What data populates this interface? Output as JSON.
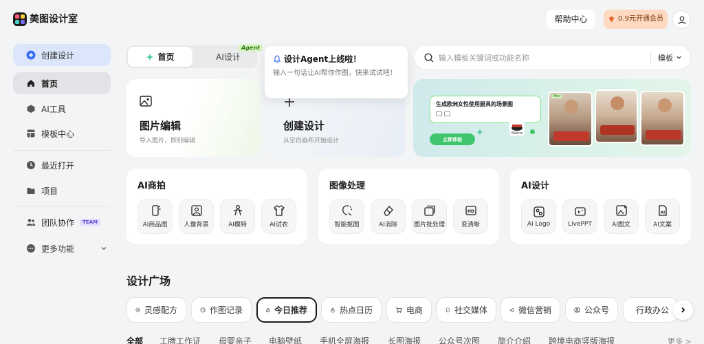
{
  "header": {
    "app_name": "美图设计室",
    "help_label": "帮助中心",
    "vip_label": "0.9元开通会员"
  },
  "sidebar": {
    "create_label": "创建设计",
    "items": [
      {
        "label": "首页"
      },
      {
        "label": "AI工具"
      },
      {
        "label": "模板中心"
      },
      {
        "label": "最近打开"
      },
      {
        "label": "项目"
      },
      {
        "label": "团队协作",
        "badge": "TEAM"
      },
      {
        "label": "更多功能"
      }
    ]
  },
  "top_tabs": {
    "home": "首页",
    "ai_design": "AI设计",
    "agent_tag": "Agent"
  },
  "popover": {
    "title": "设计Agent上线啦！",
    "body": "输入一句话让AI帮你作图，快来试试吧！"
  },
  "search": {
    "placeholder": "输入模板关键词或功能名称",
    "type_label": "模板"
  },
  "cards": {
    "edit": {
      "title": "图片编辑",
      "sub": "导入图片，即刻编辑"
    },
    "create": {
      "title": "创建设计",
      "sub": "从空白画布开始设计"
    }
  },
  "banner": {
    "prompt": "生成欧洲女性使用厨具的场景图",
    "cta": "立即体验",
    "before_tag": "Before",
    "after_tag": "After"
  },
  "groups": [
    {
      "title": "AI商拍",
      "tools": [
        "AI商品图",
        "人像背景",
        "AI模特",
        "AI试衣"
      ]
    },
    {
      "title": "图像处理",
      "tools": [
        "智能抠图",
        "AI消除",
        "图片批处理",
        "变清晰"
      ]
    },
    {
      "title": "AI设计",
      "tools": [
        "AI Logo",
        "LivePPT",
        "AI图文",
        "AI文案"
      ]
    }
  ],
  "square": {
    "title": "设计广场",
    "chips": [
      "灵感配方",
      "作图记录",
      "今日推荐",
      "热点日历",
      "电商",
      "社交媒体",
      "微信营销",
      "公众号",
      "行政办公"
    ],
    "categories": [
      "全部",
      "工牌工作证",
      "母婴亲子",
      "电脑壁纸",
      "手机全屏海报",
      "长图海报",
      "公众号次图",
      "简介介绍",
      "跨境电商竖版海报"
    ],
    "more": "更多 >"
  }
}
